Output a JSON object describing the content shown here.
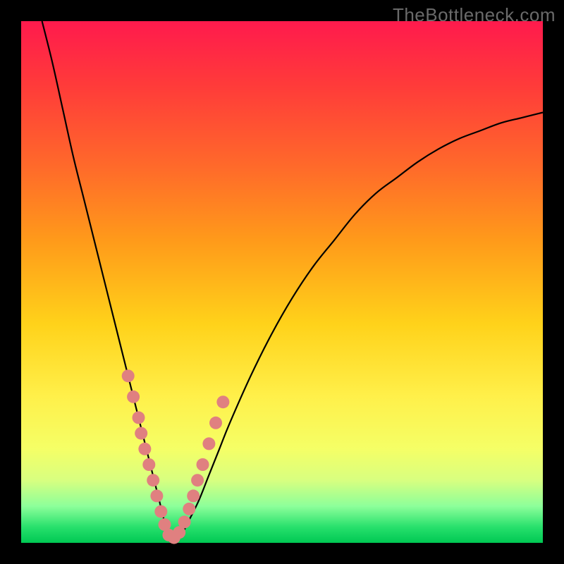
{
  "watermark": "TheBottleneck.com",
  "chart_data": {
    "type": "line",
    "title": "",
    "xlabel": "",
    "ylabel": "",
    "xlim": [
      0,
      100
    ],
    "ylim": [
      0,
      100
    ],
    "note": "Axes unlabeled in source image; x and y are approximate percentage coordinates read from pixel positions. The curve depicts a bottleneck V-shape reaching ~0 near x≈28 and rising asymptotically on both sides. Dots are sample markers clustered near the trough.",
    "series": [
      {
        "name": "bottleneck-curve",
        "x": [
          4,
          6,
          8,
          10,
          12,
          14,
          16,
          18,
          20,
          22,
          24,
          25,
          26,
          27,
          28,
          29,
          30,
          31,
          32,
          34,
          36,
          38,
          40,
          44,
          48,
          52,
          56,
          60,
          64,
          68,
          72,
          76,
          80,
          84,
          88,
          92,
          96,
          100
        ],
        "values": [
          100,
          92,
          83,
          74,
          66,
          58,
          50,
          42,
          34,
          26,
          18,
          14,
          10,
          6,
          2,
          0.5,
          1,
          2,
          4,
          8,
          13,
          18,
          23,
          32,
          40,
          47,
          53,
          58,
          63,
          67,
          70,
          73,
          75.5,
          77.5,
          79,
          80.5,
          81.5,
          82.5
        ]
      },
      {
        "name": "sample-dots",
        "x": [
          20.5,
          21.5,
          22.5,
          23,
          23.7,
          24.5,
          25.3,
          26,
          26.8,
          27.5,
          28.3,
          29.3,
          30.3,
          31.3,
          32.2,
          33,
          33.8,
          34.8,
          36,
          37.3,
          38.7
        ],
        "values": [
          32,
          28,
          24,
          21,
          18,
          15,
          12,
          9,
          6,
          3.5,
          1.5,
          1,
          2,
          4,
          6.5,
          9,
          12,
          15,
          19,
          23,
          27
        ]
      }
    ]
  }
}
